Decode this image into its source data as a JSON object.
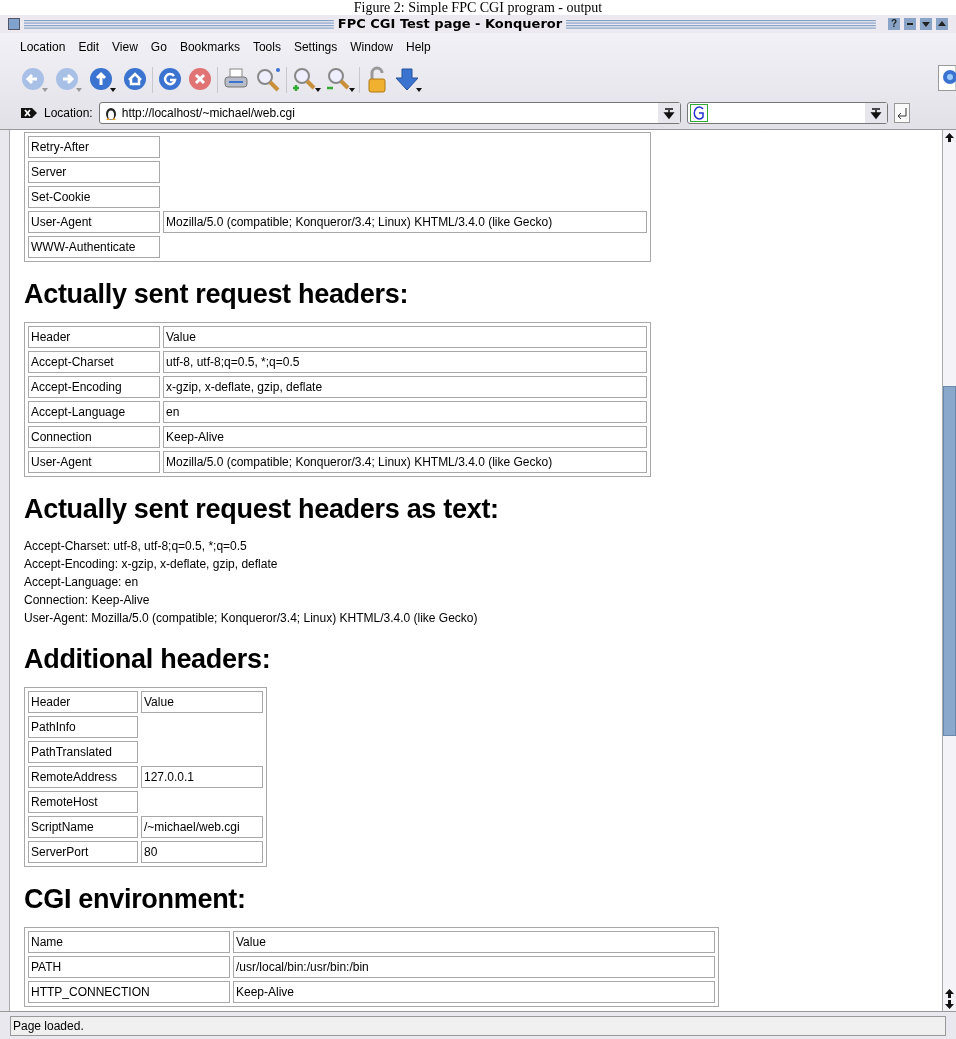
{
  "caption": "Figure 2: Simple FPC CGI program - output",
  "window": {
    "title": "FPC CGI Test page - Konqueror",
    "help_button": "?"
  },
  "menu": [
    "Location",
    "Edit",
    "View",
    "Go",
    "Bookmarks",
    "Tools",
    "Settings",
    "Window",
    "Help"
  ],
  "location_bar": {
    "label": "Location:",
    "url": "http://localhost/~michael/web.cgi"
  },
  "content": [
    {
      "kind": "table",
      "rows": [
        [
          "Retry-After"
        ],
        [
          "Server"
        ],
        [
          "Set-Cookie"
        ],
        [
          "User-Agent",
          "Mozilla/5.0 (compatible; Konqueror/3.4; Linux) KHTML/3.4.0 (like Gecko)"
        ],
        [
          "WWW-Authenticate"
        ]
      ]
    },
    {
      "kind": "heading",
      "text": "Actually sent request headers:"
    },
    {
      "kind": "table",
      "rows": [
        [
          "Header",
          "Value"
        ],
        [
          "Accept-Charset",
          "utf-8, utf-8;q=0.5, *;q=0.5"
        ],
        [
          "Accept-Encoding",
          "x-gzip, x-deflate, gzip, deflate"
        ],
        [
          "Accept-Language",
          "en"
        ],
        [
          "Connection",
          "Keep-Alive"
        ],
        [
          "User-Agent",
          "Mozilla/5.0 (compatible; Konqueror/3.4; Linux) KHTML/3.4.0 (like Gecko)"
        ]
      ]
    },
    {
      "kind": "heading",
      "text": "Actually sent request headers as text:"
    },
    {
      "kind": "text",
      "lines": [
        "Accept-Charset: utf-8, utf-8;q=0.5, *;q=0.5",
        "Accept-Encoding: x-gzip, x-deflate, gzip, deflate",
        "Accept-Language: en",
        "Connection: Keep-Alive",
        "User-Agent: Mozilla/5.0 (compatible; Konqueror/3.4; Linux) KHTML/3.4.0 (like Gecko)"
      ]
    },
    {
      "kind": "heading",
      "text": "Additional headers:"
    },
    {
      "kind": "table",
      "rows": [
        [
          "Header",
          "Value"
        ],
        [
          "PathInfo"
        ],
        [
          "PathTranslated"
        ],
        [
          "RemoteAddress",
          "127.0.0.1"
        ],
        [
          "RemoteHost"
        ],
        [
          "ScriptName",
          "/~michael/web.cgi"
        ],
        [
          "ServerPort",
          "80"
        ]
      ]
    },
    {
      "kind": "heading",
      "text": "CGI environment:"
    },
    {
      "kind": "table",
      "rows": [
        [
          "Name",
          "Value"
        ],
        [
          "PATH",
          "/usr/local/bin:/usr/bin:/bin"
        ],
        [
          "HTTP_CONNECTION",
          "Keep-Alive"
        ]
      ]
    }
  ],
  "status_bar": "Page loaded."
}
